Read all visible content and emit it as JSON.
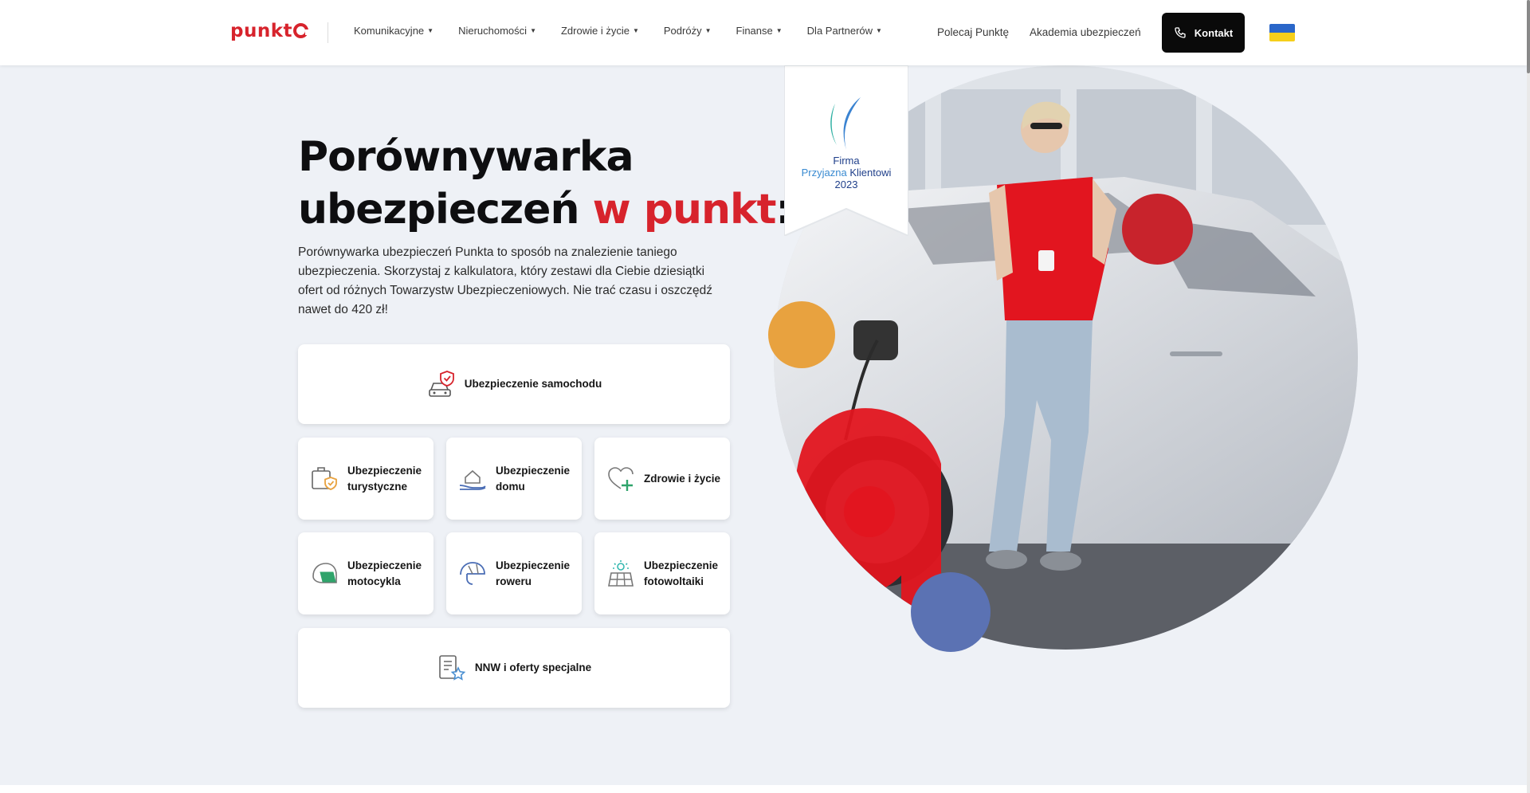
{
  "header": {
    "logo_text": "punkt",
    "nav": [
      {
        "label": "Komunikacyjne"
      },
      {
        "label": "Nieruchomości"
      },
      {
        "label": "Zdrowie i życie"
      },
      {
        "label": "Podróży"
      },
      {
        "label": "Finanse"
      },
      {
        "label": "Dla Partnerów"
      }
    ],
    "links": {
      "polecaj": "Polecaj Punktę",
      "akademia": "Akademia ubezpieczeń"
    },
    "contact_label": "Kontakt",
    "language_flag": "ukraine-flag-icon"
  },
  "hero": {
    "title_line1": "Porównywarka",
    "title_line2": "ubezpieczeń",
    "title_accent": "w punkt",
    "title_end": ":",
    "lead": "Porównywarka ubezpieczeń Punkta to sposób na znalezienie taniego ubezpieczenia. Skorzystaj z kalkulatora, który zestawi dla Ciebie dziesiątki ofert od różnych Towarzystw Ubezpieczeniowych. Nie trać czasu i oszczędź nawet do 420 zł!"
  },
  "products": {
    "car": {
      "label": "Ubezpieczenie samochodu",
      "icon": "car-shield-icon"
    },
    "travel": {
      "label": "Ubezpieczenie turystyczne",
      "icon": "suitcase-shield-icon"
    },
    "home": {
      "label": "Ubezpieczenie domu",
      "icon": "house-hand-icon"
    },
    "health": {
      "label": "Zdrowie i życie",
      "icon": "heart-cross-icon"
    },
    "moto": {
      "label": "Ubezpieczenie motocykla",
      "icon": "motorcycle-helmet-icon"
    },
    "bike": {
      "label": "Ubezpieczenie roweru",
      "icon": "bike-helmet-icon"
    },
    "solar": {
      "label": "Ubezpieczenie fotowoltaiki",
      "icon": "solar-panel-icon"
    },
    "nnw": {
      "label": "NNW i oferty specjalne",
      "icon": "document-star-icon"
    }
  },
  "award": {
    "line1": "Firma",
    "line2a": "Przyjazna",
    "line2b": "Klientowi",
    "year": "2023"
  },
  "colors": {
    "brand_red": "#d7232c",
    "dark": "#0a0a0a",
    "bg": "#eef1f6",
    "orange_dot": "#e8a23f",
    "blue_dot": "#5b72b3"
  }
}
